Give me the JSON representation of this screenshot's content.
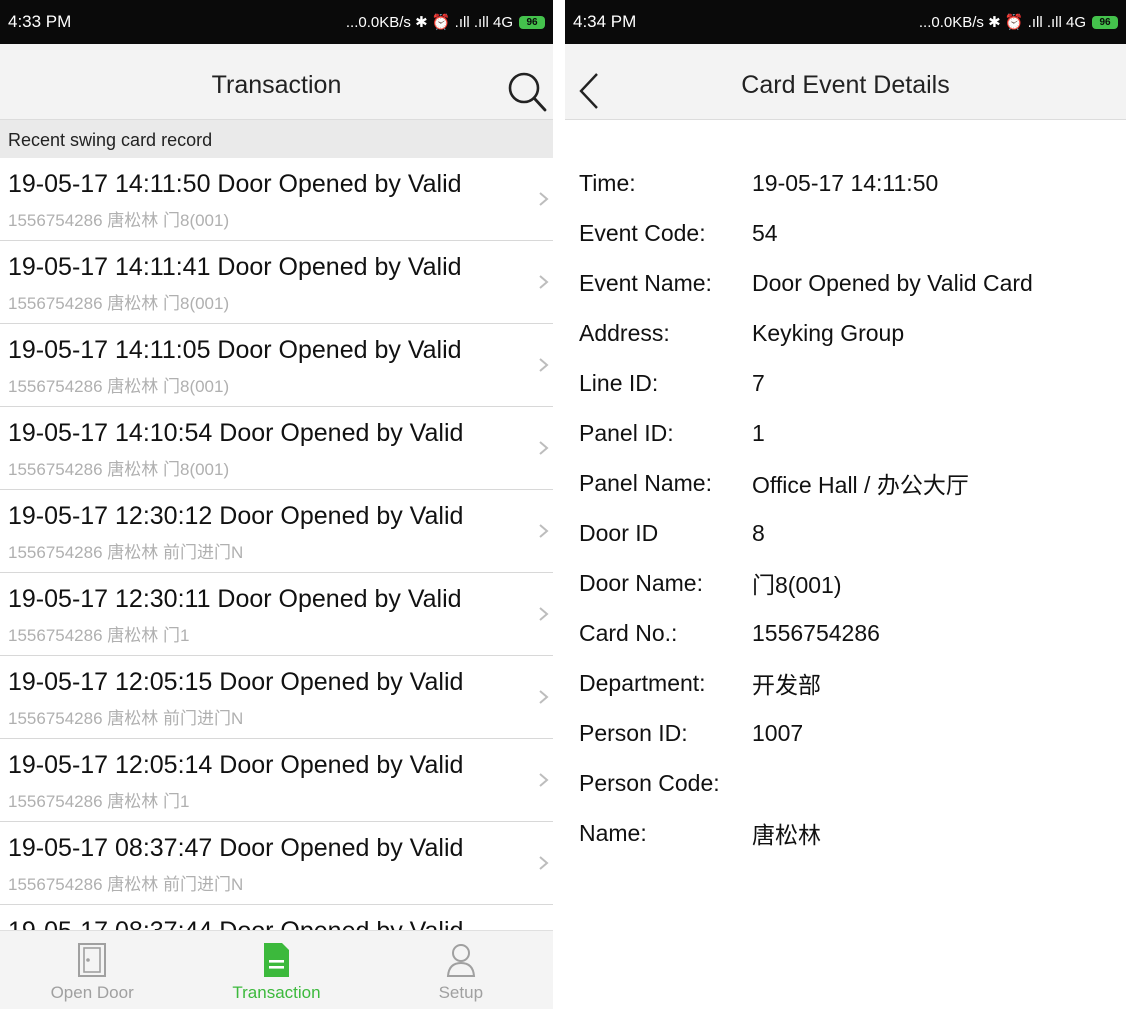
{
  "left": {
    "status": {
      "time": "4:33 PM",
      "indicators": "...0.0KB/s ✱ ⏰ .ıll .ıll 4G",
      "battery": "96"
    },
    "header": {
      "title": "Transaction"
    },
    "section_title": "Recent swing card record",
    "records": [
      {
        "title": "19-05-17 14:11:50  Door Opened by Valid",
        "subtitle": "1556754286 唐松林 门8(001)"
      },
      {
        "title": "19-05-17 14:11:41  Door Opened by Valid",
        "subtitle": "1556754286 唐松林 门8(001)"
      },
      {
        "title": "19-05-17 14:11:05  Door Opened by Valid",
        "subtitle": "1556754286 唐松林 门8(001)"
      },
      {
        "title": "19-05-17 14:10:54  Door Opened by Valid",
        "subtitle": "1556754286 唐松林 门8(001)"
      },
      {
        "title": "19-05-17 12:30:12  Door Opened by Valid",
        "subtitle": "1556754286 唐松林 前门进门N"
      },
      {
        "title": "19-05-17 12:30:11  Door Opened by Valid",
        "subtitle": "1556754286 唐松林 门1"
      },
      {
        "title": "19-05-17 12:05:15  Door Opened by Valid",
        "subtitle": "1556754286 唐松林 前门进门N"
      },
      {
        "title": "19-05-17 12:05:14  Door Opened by Valid",
        "subtitle": "1556754286 唐松林 门1"
      },
      {
        "title": "19-05-17 08:37:47  Door Opened by Valid",
        "subtitle": "1556754286 唐松林 前门进门N"
      },
      {
        "title": "19-05-17 08:37:44  Door Opened by Valid",
        "subtitle": ""
      }
    ],
    "tabs": [
      {
        "label": "Open Door",
        "icon": "door-icon"
      },
      {
        "label": "Transaction",
        "icon": "document-icon"
      },
      {
        "label": "Setup",
        "icon": "person-icon"
      }
    ],
    "accent_color": "#3cb93c"
  },
  "right": {
    "status": {
      "time": "4:34 PM",
      "indicators": "...0.0KB/s ✱ ⏰ .ıll .ıll 4G",
      "battery": "96"
    },
    "header": {
      "title": "Card Event Details"
    },
    "details": [
      {
        "label": "Time:",
        "value": "19-05-17 14:11:50"
      },
      {
        "label": "Event Code:",
        "value": "54"
      },
      {
        "label": "Event Name:",
        "value": "Door Opened by Valid Card"
      },
      {
        "label": "Address:",
        "value": "Keyking Group"
      },
      {
        "label": "Line ID:",
        "value": "7"
      },
      {
        "label": "Panel ID:",
        "value": "1"
      },
      {
        "label": "Panel Name:",
        "value": "Office Hall / 办公大厅"
      },
      {
        "label": "Door ID",
        "value": "8"
      },
      {
        "label": "Door Name:",
        "value": "门8(001)"
      },
      {
        "label": "Card No.:",
        "value": "1556754286"
      },
      {
        "label": "Department:",
        "value": "开发部"
      },
      {
        "label": "Person ID:",
        "value": "1007"
      },
      {
        "label": "Person Code:",
        "value": ""
      },
      {
        "label": "Name:",
        "value": "唐松林"
      }
    ]
  }
}
